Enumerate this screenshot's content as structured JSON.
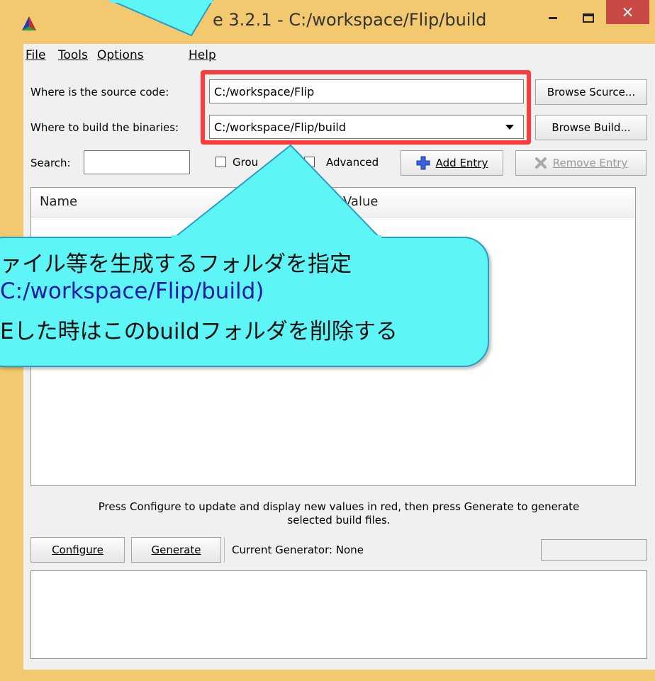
{
  "window": {
    "title": "e 3.2.1 - C:/workspace/Flip/build",
    "close_glyph": "×"
  },
  "menu": [
    {
      "label": "File"
    },
    {
      "label": "Tools"
    },
    {
      "label": "Options"
    },
    {
      "label": "Help"
    }
  ],
  "source": {
    "label": "Where is the source code:",
    "value": "C:/workspace/Flip",
    "browse_label": "Browse Scurce..."
  },
  "build": {
    "label": "Where to build the binaries:",
    "value": "C:/workspace/Flip/build",
    "browse_label": "Browse Build..."
  },
  "toolbar": {
    "search_label": "Search:",
    "search_value": "",
    "grouped_label": "Grou",
    "advanced_label": "Advanced",
    "add_entry_label": "Add Entry",
    "remove_entry_label": "Remove Entry"
  },
  "table": {
    "columns": [
      "Name",
      "Value"
    ]
  },
  "status": {
    "hint_line1": "Press Configure to update and display new values in red, then press Generate to generate",
    "hint_line2": "selected build files.",
    "configure_label": "Configure",
    "generate_label": "Generate",
    "current_generator": "Current Generator: None"
  },
  "callout": {
    "line1": "ァイル等を生成するフォルダを指定",
    "line2": "C:/workspace/Flip/build)",
    "line3": "Eした時はこのbuildフォルダを削除する"
  },
  "colors": {
    "frame": "#f2c96f",
    "close": "#c74a45",
    "highlight": "#ff3a3a",
    "callout": "#5ef5f7",
    "path_blue": "#1a1aa8"
  }
}
